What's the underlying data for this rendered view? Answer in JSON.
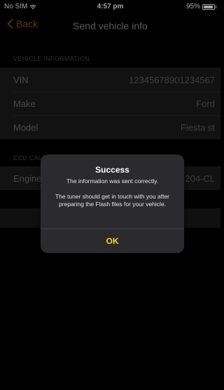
{
  "status_bar": {
    "carrier": "No SIM",
    "time": "4:57 pm",
    "battery": "95%",
    "battery_level": 0.95
  },
  "nav": {
    "back_label": "Back",
    "title": "Send vehicle info"
  },
  "vehicle_section": {
    "header": "VEHICLE INFORMATION",
    "rows": [
      {
        "label": "VIN",
        "value": "12345678901234567"
      },
      {
        "label": "Make",
        "value": "Ford"
      },
      {
        "label": "Model",
        "value": "Fiesta st"
      }
    ]
  },
  "ecu_section": {
    "header": "ECU CAL",
    "rows": [
      {
        "label": "Engine",
        "value": "204-CL"
      }
    ]
  },
  "alert": {
    "title": "Success",
    "message": "The information was sent correctly.\n\nThe tuner should get in touch with you after preparing the Flash files for your vehicle.",
    "ok_label": "OK"
  },
  "colors": {
    "accent_orange": "#ff9f0a",
    "ok_yellow": "#ffd60a",
    "background": "#000000"
  }
}
